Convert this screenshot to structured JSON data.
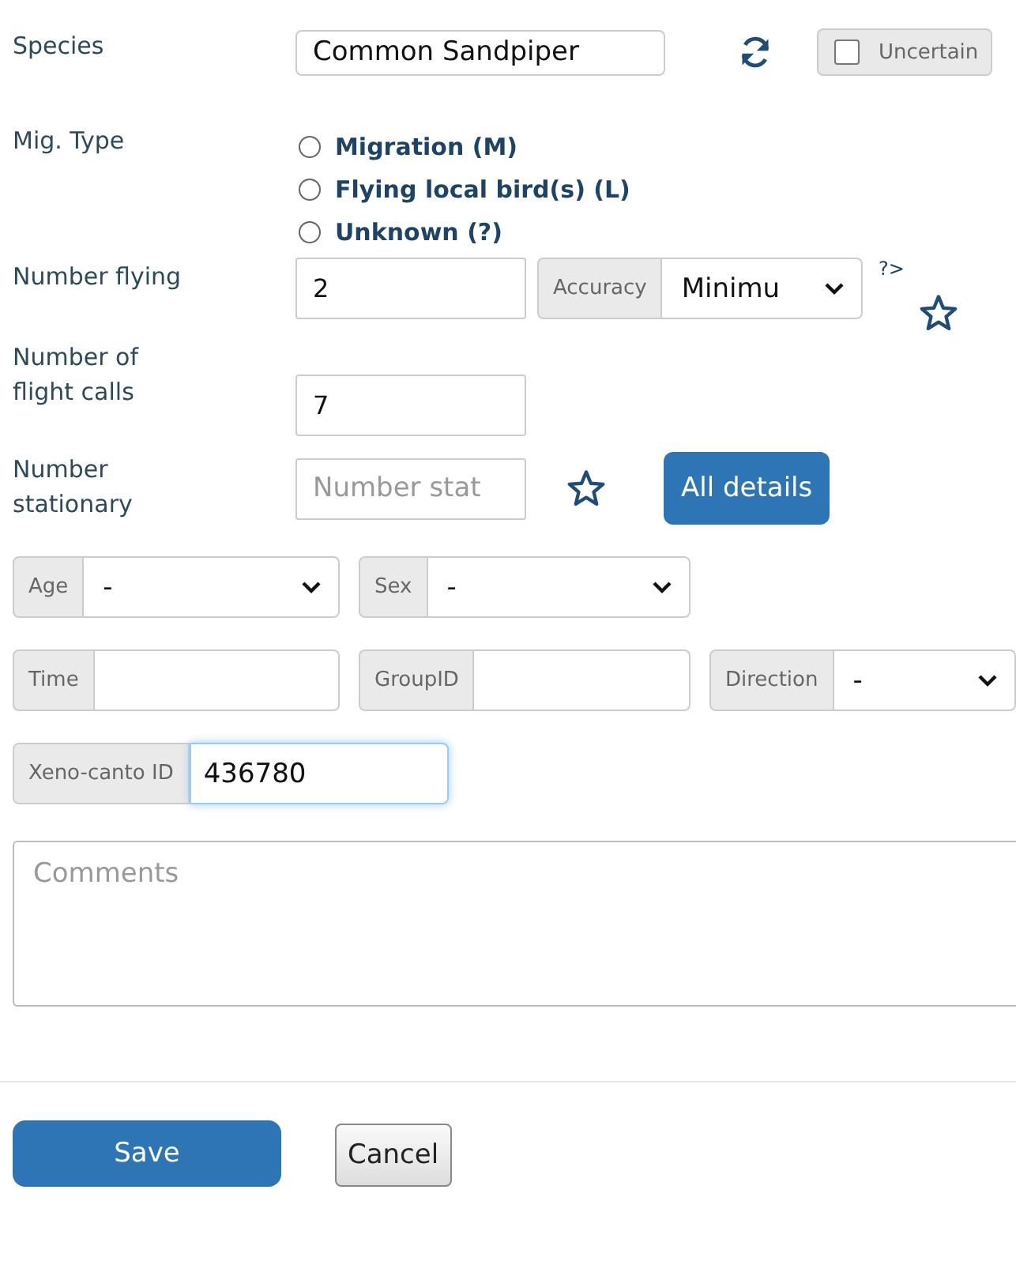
{
  "species": {
    "label": "Species",
    "value": "Common Sandpiper",
    "uncertain": {
      "label": "Uncertain",
      "checked": false
    }
  },
  "mig_type": {
    "label": "Mig. Type",
    "options": [
      {
        "label": "Migration (M)",
        "selected": false
      },
      {
        "label": "Flying local bird(s) (L)",
        "selected": false
      },
      {
        "label": "Unknown (?)",
        "selected": false
      }
    ]
  },
  "number_flying": {
    "label": "Number flying",
    "value": "2",
    "accuracy": {
      "label": "Accuracy",
      "value": "Minimu"
    },
    "help": "?>"
  },
  "flight_calls": {
    "label": "Number of flight calls",
    "value": "7"
  },
  "number_stationary": {
    "label": "Number stationary",
    "placeholder": "Number stat",
    "button": "All details"
  },
  "groups": [
    [
      {
        "label": "Age",
        "kind": "select",
        "value": "-"
      },
      {
        "label": "Sex",
        "kind": "select",
        "value": "-"
      }
    ],
    [
      {
        "label": "Time",
        "kind": "text",
        "focused": false
      },
      {
        "label": "GroupID",
        "kind": "text",
        "focused": false
      },
      {
        "label": "Direction",
        "kind": "select",
        "value": "-"
      }
    ],
    [
      {
        "label": "Xeno-canto ID",
        "kind": "text",
        "value": "436780",
        "focused": true
      }
    ]
  ],
  "comments": {
    "placeholder": "Comments"
  },
  "buttons": [
    {
      "label": "Save",
      "kind": "primary"
    },
    {
      "label": "Cancel",
      "kind": "secondary"
    }
  ]
}
